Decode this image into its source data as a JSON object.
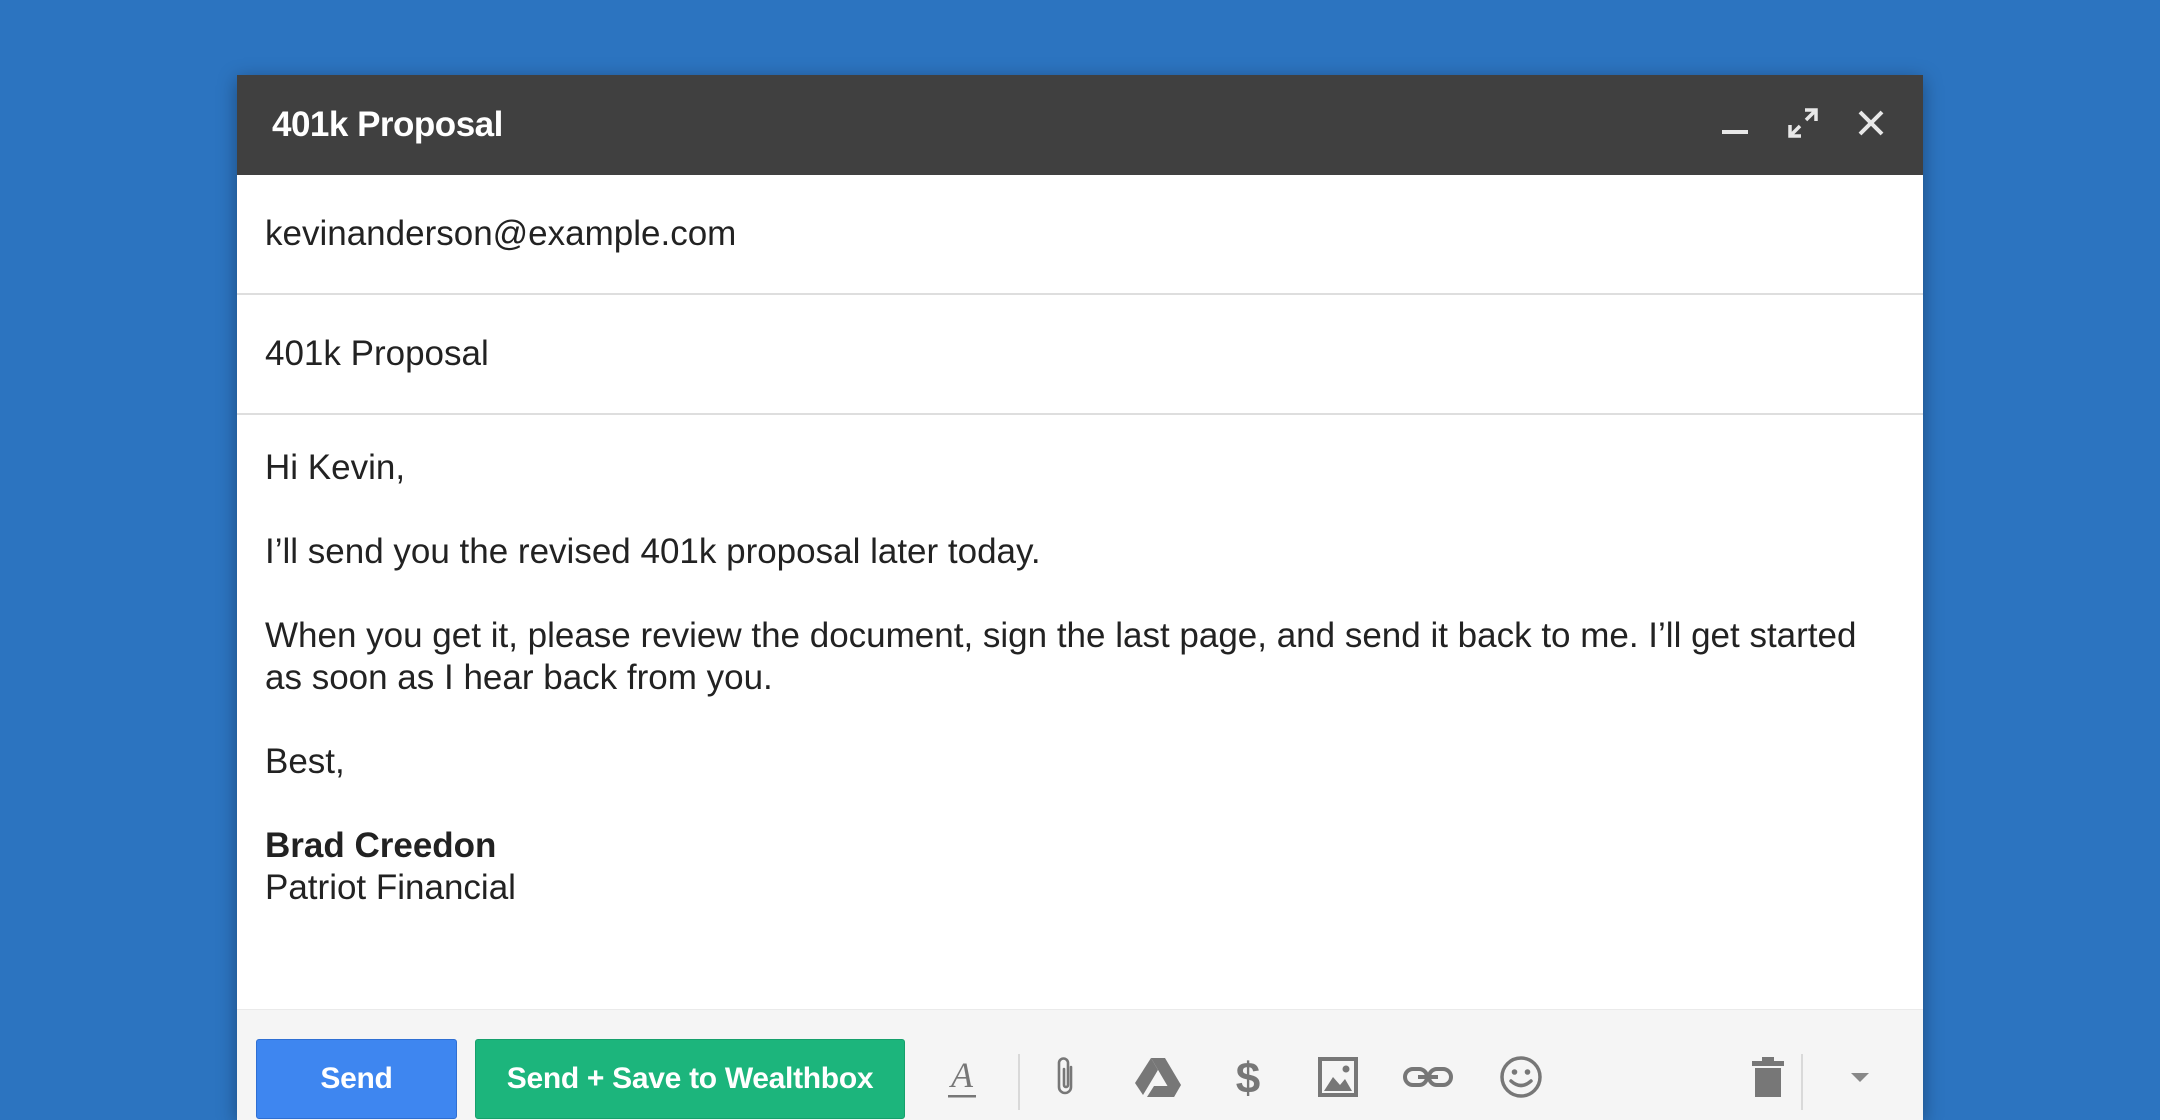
{
  "compose": {
    "title": "401k Proposal",
    "to": "kevinanderson@example.com",
    "subject": "401k Proposal",
    "body": {
      "greeting": "Hi Kevin,",
      "line1": "I’ll send you the revised 401k proposal later today.",
      "line2": "When you get it, please review the document, sign the last page, and send it back to me. I’ll get started as soon as I hear back from you.",
      "closing": "Best,",
      "signature_name": "Brad Creedon",
      "signature_company": "Patriot Financial"
    }
  },
  "toolbar": {
    "send_label": "Send",
    "send_save_label": "Send + Save to Wealthbox"
  },
  "icons": {
    "minimize": "minimize-icon",
    "expand": "expand-icon",
    "close": "close-icon",
    "formatting": "formatting-icon",
    "attach": "paperclip-icon",
    "drive": "drive-icon",
    "money": "dollar-icon",
    "photo": "photo-icon",
    "link": "link-icon",
    "emoji": "emoji-icon",
    "trash": "trash-icon",
    "more": "chevron-down-icon"
  },
  "colors": {
    "background": "#2c74c0",
    "titlebar": "#404040",
    "send_button": "#3e86f0",
    "wealthbox_button": "#1cb57c",
    "icon_gray": "#777777"
  }
}
